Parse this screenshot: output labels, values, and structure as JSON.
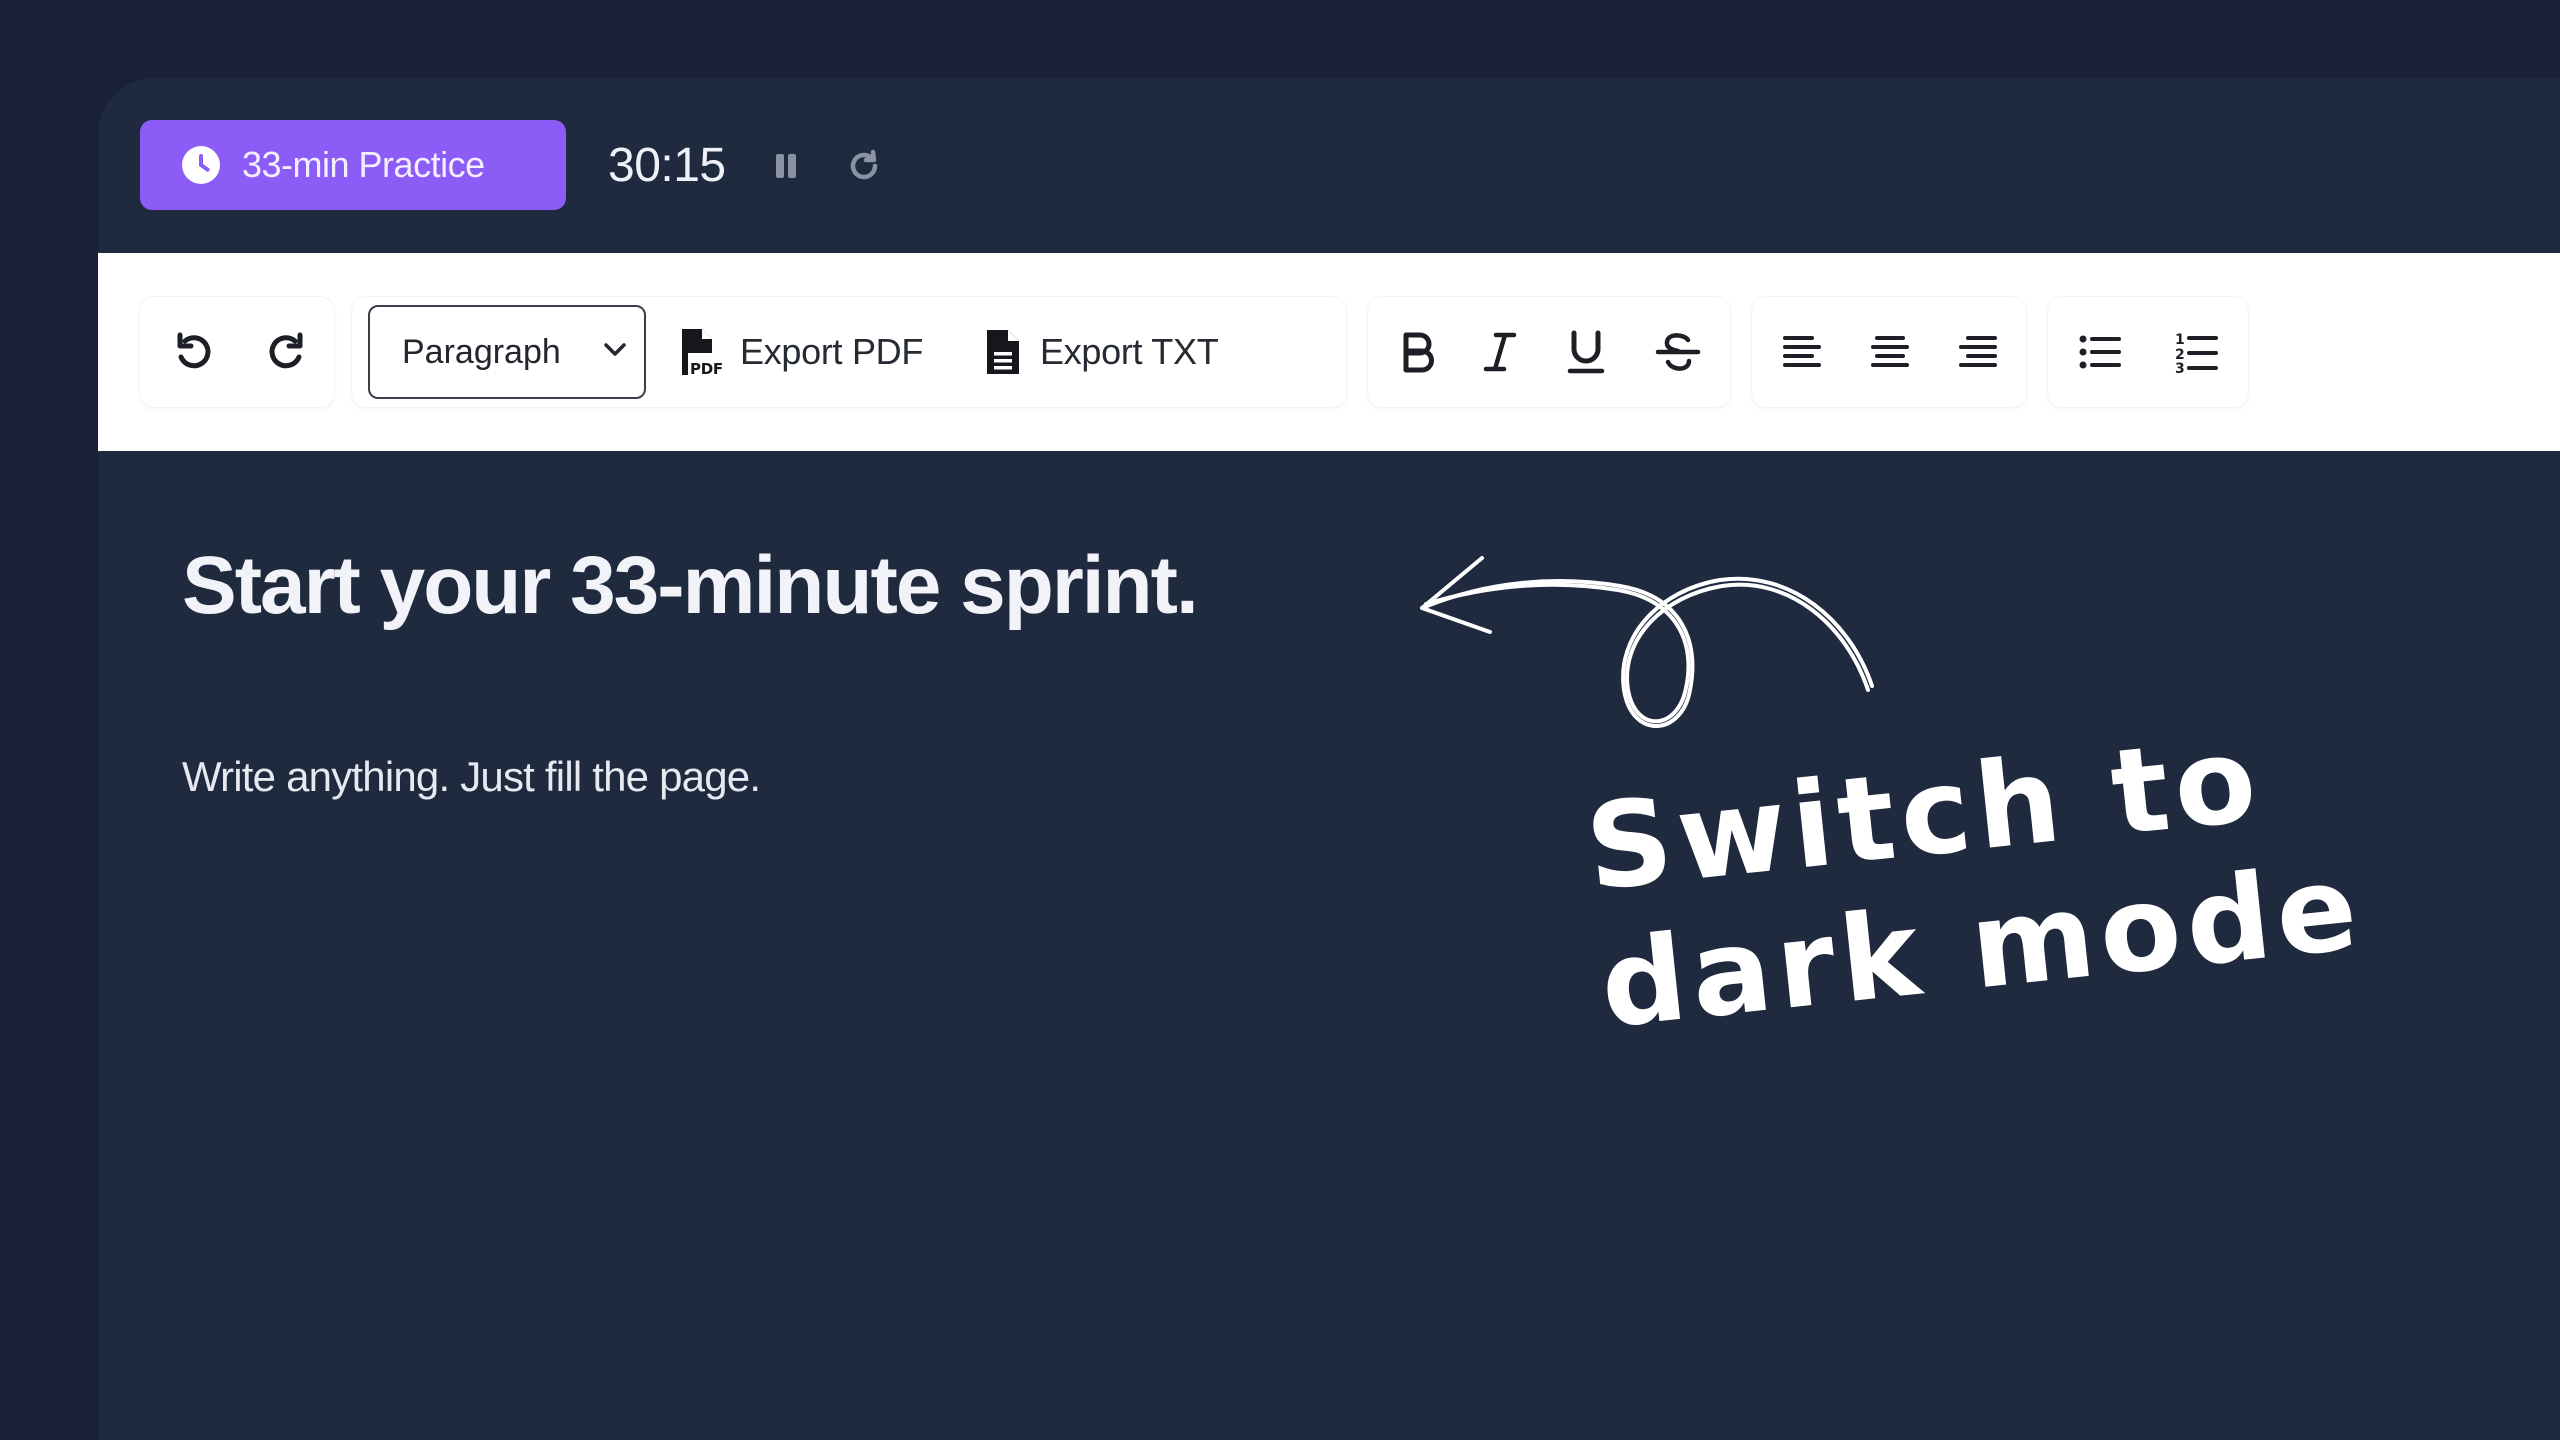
{
  "topbar": {
    "practice_label": "33-min Practice",
    "timer": "30:15"
  },
  "toolbar": {
    "block_select": "Paragraph",
    "export_pdf_label": "Export PDF",
    "export_txt_label": "Export TXT",
    "icons": {
      "undo": "undo-icon",
      "redo": "redo-icon",
      "bold": "bold-icon",
      "italic": "italic-icon",
      "underline": "underline-icon",
      "strikethrough": "strikethrough-icon",
      "align_left": "align-left-icon",
      "align_center": "align-center-icon",
      "align_right": "align-right-icon",
      "bullet_list": "bullet-list-icon",
      "numbered_list": "numbered-list-icon"
    }
  },
  "editor": {
    "heading": "Start your 33-minute sprint.",
    "paragraph": "Write anything. Just fill the page."
  },
  "annotation": {
    "line1": "Switch to",
    "line2": "dark mode"
  },
  "colors": {
    "page_background": "#18203a",
    "window_background": "#1f2a3f",
    "accent": "#8b5cf6",
    "toolbar_background": "#ffffff"
  }
}
